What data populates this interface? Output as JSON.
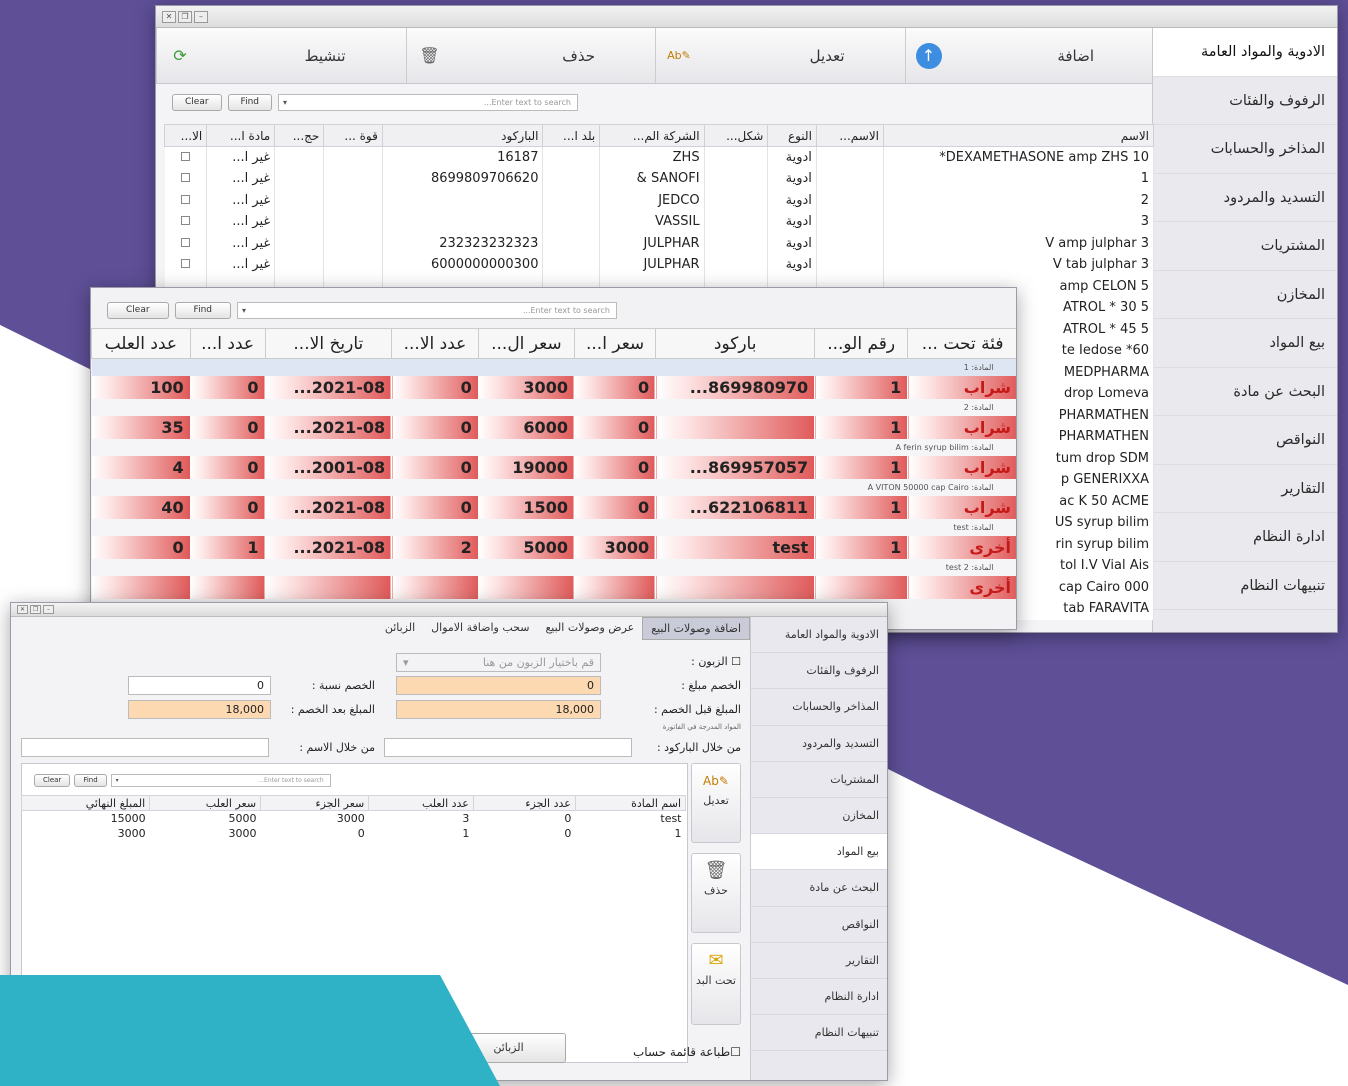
{
  "colors": {
    "purple": "#5e4f97",
    "cyan": "#2fb1c6",
    "row_red": "#e05a5a",
    "orange_field": "#fcd9b1"
  },
  "main_window": {
    "toolbar": [
      {
        "label": "اضافة",
        "icon": "add-icon"
      },
      {
        "label": "تعديل",
        "icon": "edit-icon"
      },
      {
        "label": "حذف",
        "icon": "trash-icon"
      },
      {
        "label": "تنشيط",
        "icon": "refresh-icon"
      }
    ],
    "sidebar": [
      "الادوية والمواد العامة",
      "الرفوف والفئات",
      "المذاخر والحسابات",
      "التسديد والمردود",
      "المشتريات",
      "المخازن",
      "بيع المواد",
      "البحث عن مادة",
      "النواقص",
      "التقارير",
      "ادارة النظام",
      "تنبيهات النظام"
    ],
    "search": {
      "clear": "Clear",
      "find": "Find",
      "placeholder": "Enter text to search..."
    },
    "columns": [
      "الاسم",
      "الاسم...",
      "النوع",
      "شكل...",
      "الشركة الم...",
      "بلد ا...",
      "الباركود",
      "قوة ...",
      "حج...",
      "مادة ا...",
      "الا..."
    ],
    "rows": [
      {
        "name": "DEXAMETHASONE amp ZHS 10*",
        "type": "ادوية",
        "company": "ZHS",
        "barcode": "16187",
        "material": "غير ا..."
      },
      {
        "name": "1",
        "type": "ادوية",
        "company": "SANOFI &",
        "barcode": "8699809706620",
        "material": "غير ا..."
      },
      {
        "name": "2",
        "type": "ادوية",
        "company": "JEDCO",
        "barcode": "",
        "material": "غير ا..."
      },
      {
        "name": "3",
        "type": "ادوية",
        "company": "VASSIL",
        "barcode": "",
        "material": "غير ا..."
      },
      {
        "name": "V amp julphar 3",
        "type": "ادوية",
        "company": "JULPHAR",
        "barcode": "232323232323",
        "material": "غير ا..."
      },
      {
        "name": "V tab julphar 3",
        "type": "ادوية",
        "company": "JULPHAR",
        "barcode": "6000000000300",
        "material": "غير ا..."
      }
    ],
    "peek_names": [
      "amp CELON 5",
      "ATROL * 30 5",
      "ATROL * 45 5",
      "te Iedose *60",
      "MEDPHARMA",
      "drop Lomeva",
      "PHARMATHEN",
      "PHARMATHEN",
      "tum drop SDM",
      "p GENERIXXA",
      "ac K 50 ACME",
      "US syrup bilim",
      "rin syrup bilim",
      "tol I.V Vial Ais",
      "000 cap Cairo",
      "tab FARAVITA"
    ]
  },
  "batch_window": {
    "search": {
      "clear": "Clear",
      "find": "Find",
      "placeholder": "Enter text to search..."
    },
    "columns": [
      "فئة تحت ...",
      "رقم الو...",
      "باركود",
      "سعر ا...",
      "سعر ال...",
      "عدد الا...",
      "تاريخ الا...",
      "عدد ا...",
      "عدد العلب"
    ],
    "groups": [
      "المادة: 1",
      "المادة: 2",
      "المادة: A ferin syrup bilim",
      "المادة: A VITON 50000 cap Cairo",
      "المادة: test",
      "المادة: test 2"
    ],
    "rows": [
      {
        "category": "شراب",
        "num": "1",
        "barcode": "...869980970",
        "p1": "0",
        "p2": "3000",
        "c1": "0",
        "date": "...2021-08",
        "c2": "0",
        "boxes": "100"
      },
      {
        "category": "شراب",
        "num": "1",
        "barcode": "",
        "p1": "0",
        "p2": "6000",
        "c1": "0",
        "date": "...2021-08",
        "c2": "0",
        "boxes": "35"
      },
      {
        "category": "شراب",
        "num": "1",
        "barcode": "...869957057",
        "p1": "0",
        "p2": "19000",
        "c1": "0",
        "date": "...2001-08",
        "c2": "0",
        "boxes": "4"
      },
      {
        "category": "شراب",
        "num": "1",
        "barcode": "...622106811",
        "p1": "0",
        "p2": "1500",
        "c1": "0",
        "date": "...2021-08",
        "c2": "0",
        "boxes": "40"
      },
      {
        "category": "أخرى",
        "num": "1",
        "barcode": "test",
        "p1": "3000",
        "p2": "5000",
        "c1": "2",
        "date": "...2021-08",
        "c2": "1",
        "boxes": "0"
      }
    ],
    "last_category": "أخرى"
  },
  "sales_window": {
    "sidebar": [
      "الادوية والمواد العامة",
      "الرفوف والفئات",
      "المذاخر والحسابات",
      "التسديد والمردود",
      "المشتريات",
      "المخازن",
      "بيع المواد",
      "البحث عن مادة",
      "النواقص",
      "التقارير",
      "ادارة النظام",
      "تنبيهات النظام"
    ],
    "tabs": [
      "اضافة وصولات البيع",
      "عرض وصولات البيع",
      "سحب واضافة الاموال",
      "الزبائن"
    ],
    "customers_label": "الزبون :",
    "customers_placeholder": "قم باختيار الزبون من هنا",
    "discount_amount_label": "الخصم مبلغ :",
    "discount_amount": "0",
    "discount_pct_label": "الخصم نسبة :",
    "discount_pct": "0",
    "before_label": "المبلغ قبل الخصم :",
    "before": "18,000",
    "after_label": "المبلغ بعد الخصم :",
    "after": "18,000",
    "hint": "المواد المدرجة في الفاتورة",
    "by_barcode": "من خلال الباركود :",
    "by_name": "من خلال الاسم :",
    "search": {
      "clear": "Clear",
      "find": "Find",
      "placeholder": "Enter text to search..."
    },
    "columns": [
      "اسم المادة",
      "عدد الجزء",
      "عدد العلب",
      "سعر الجزء",
      "سعر العلب",
      "المبلغ النهائي"
    ],
    "rows": [
      {
        "name": "test",
        "parts": "0",
        "boxes": "3",
        "part_price": "3000",
        "box_price": "5000",
        "total": "15000"
      },
      {
        "name": "1",
        "parts": "0",
        "boxes": "1",
        "part_price": "0",
        "box_price": "3000",
        "total": "3000"
      }
    ],
    "actions": [
      {
        "label": "تعديل",
        "icon": "edit-icon"
      },
      {
        "label": "حذف",
        "icon": "trash-icon"
      },
      {
        "label": "تحت البد",
        "icon": "save-icon"
      }
    ],
    "print_label": "طباعة قائمة حساب",
    "customers_button": "الزبائن"
  }
}
